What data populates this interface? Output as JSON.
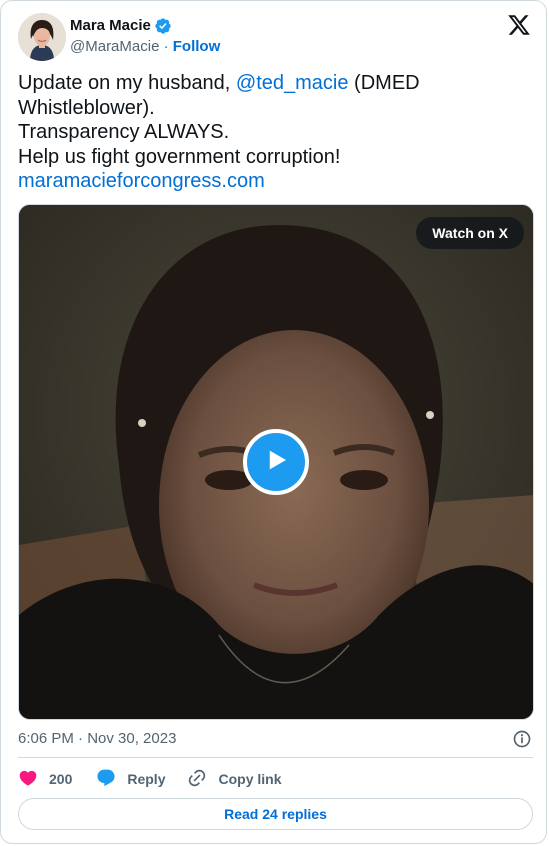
{
  "author": {
    "name": "Mara Macie",
    "handle": "@MaraMacie",
    "separator": "·",
    "follow_label": "Follow",
    "verified_icon": "verified-badge-icon",
    "platform_logo": "x-logo-icon"
  },
  "tweet": {
    "line1_prefix": "Update on my husband, ",
    "mention": "@ted_macie",
    "line1_suffix": " (DMED Whistleblower).",
    "line2": "Transparency ALWAYS.",
    "line3": "Help us fight government corruption!",
    "link": "maramacieforcongress.com"
  },
  "media": {
    "watch_label": "Watch on X",
    "play_icon": "play-icon"
  },
  "meta": {
    "timestamp": "6:06 PM · Nov 30, 2023",
    "info_icon": "info-icon"
  },
  "actions": {
    "likes_count": "200",
    "reply_label": "Reply",
    "copy_label": "Copy link"
  },
  "footer": {
    "read_replies_label": "Read 24 replies"
  },
  "colors": {
    "link": "#006fd6",
    "brand_blue": "#1d9bf0",
    "like_pink": "#f91880",
    "muted": "#536471",
    "border": "#cfd9de"
  }
}
